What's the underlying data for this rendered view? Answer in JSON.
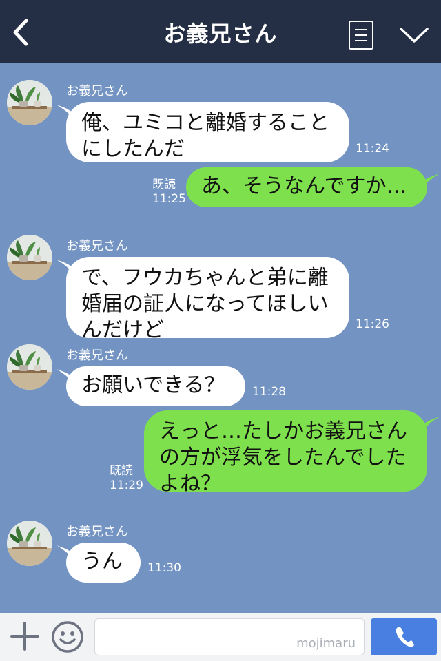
{
  "header": {
    "title": "お義兄さん"
  },
  "messages": [
    {
      "side": "in",
      "sender": "お義兄さん",
      "text": "俺、ユミコと離婚することにしたんだ",
      "time": "11:24"
    },
    {
      "side": "out",
      "read": "既読",
      "text": "あ、そうなんですか…",
      "time": "11:25"
    },
    {
      "side": "in",
      "sender": "お義兄さん",
      "text": "で、フウカちゃんと弟に離婚届の証人になってほしいんだけど",
      "time": "11:26"
    },
    {
      "side": "in",
      "sender": "お義兄さん",
      "text": "お願いできる？",
      "time": "11:28"
    },
    {
      "side": "out",
      "read": "既読",
      "text": "えっと…たしかお義兄さんの方が浮気をしたんでしたよね？",
      "time": "11:29"
    },
    {
      "side": "in",
      "sender": "お義兄さん",
      "text": "うん",
      "time": "11:30"
    }
  ],
  "input": {
    "watermark": "mojimaru"
  },
  "icons": {
    "back": "chevron-left-icon",
    "menu": "list-icon",
    "more": "chevron-down-icon",
    "add": "plus-icon",
    "emoji": "smiley-icon",
    "call": "phone-icon"
  },
  "colors": {
    "header_bg": "#242e45",
    "chat_bg": "#7394c3",
    "incoming_bubble": "#ffffff",
    "outgoing_bubble": "#7fe04e",
    "call_button": "#4a7fe2"
  }
}
